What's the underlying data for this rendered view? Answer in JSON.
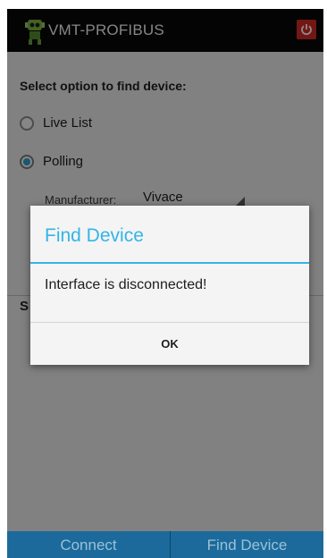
{
  "app": {
    "title": "VMT-PROFIBUS",
    "logo_icon": "robot-icon",
    "power_icon": "power-icon",
    "power_color": "#d12a25"
  },
  "form": {
    "prompt": "Select option to find device:",
    "options": [
      {
        "label": "Live List",
        "selected": false
      },
      {
        "label": "Polling",
        "selected": true
      }
    ],
    "manufacturer_label": "Manufacturer:",
    "manufacturer_value": "Vivace",
    "section_letter": "S"
  },
  "dialog": {
    "title": "Find Device",
    "message": "Interface is disconnected!",
    "ok_label": "OK",
    "accent_color": "#33b5e5"
  },
  "bottom_bar": {
    "connect_label": "Connect",
    "find_device_label": "Find Device",
    "color": "#1b6a9b"
  }
}
